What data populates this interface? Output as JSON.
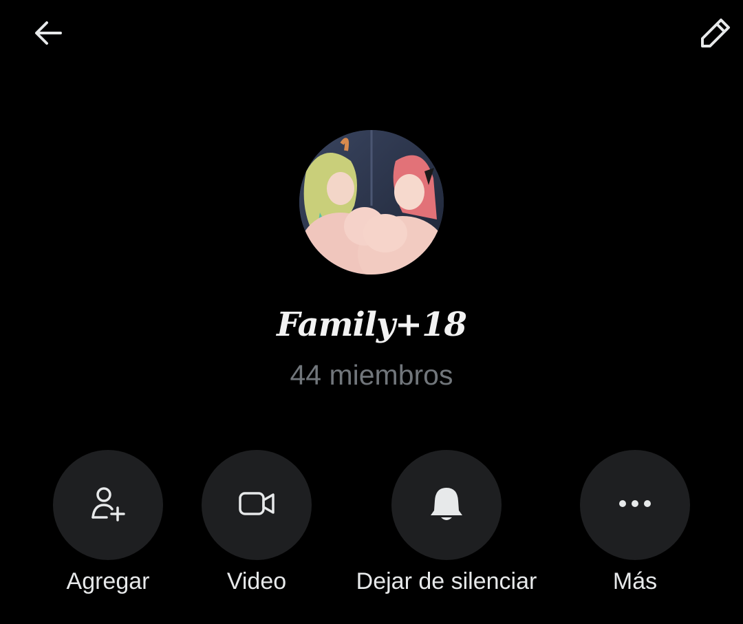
{
  "header": {
    "back_icon": "arrow-left-icon",
    "edit_icon": "pencil-icon"
  },
  "group": {
    "name": "Family+18",
    "members": "44 miembros"
  },
  "actions": [
    {
      "label": "Agregar",
      "icon": "add-user-icon"
    },
    {
      "label": "Video",
      "icon": "video-camera-icon"
    },
    {
      "label": "Dejar de silenciar",
      "icon": "bell-icon"
    },
    {
      "label": "Más",
      "icon": "more-dots-icon"
    }
  ],
  "colors": {
    "background": "#000000",
    "text": "#e7e9ea",
    "secondary_text": "#71767b",
    "button_bg": "#1e1f21"
  }
}
